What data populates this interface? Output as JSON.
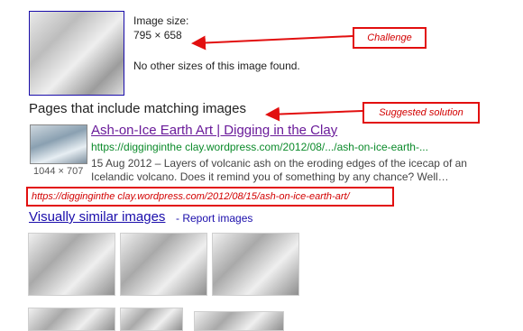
{
  "image_info": {
    "size_label": "Image size:",
    "size_value": "795 × 658",
    "other_sizes": "No other sizes of this image found."
  },
  "section": {
    "pages_title": "Pages that include matching images"
  },
  "result": {
    "title": "Ash-on-Ice Earth Art | Digging in the Clay",
    "url": "https://digginginthe clay.wordpress.com/2012/08/.../ash-on-ice-earth-...",
    "thumb_dims": "1044 × 707",
    "snippet": "15 Aug 2012 – Layers of volcanic ash on the eroding edges of the icecap of an Icelandic volcano. Does it remind you of something by any chance? Well…"
  },
  "annotations": {
    "challenge": "Challenge",
    "suggested": "Suggested solution",
    "full_url": "https://digginginthe clay.wordpress.com/2012/08/15/ash-on-ice-earth-art/"
  },
  "similar": {
    "link": "Visually similar images",
    "report": "- Report images"
  },
  "colors": {
    "link_blue": "#1a0dab",
    "visited_purple": "#6a1b9a",
    "url_green": "#0b8a2a",
    "annotation_red": "#e20f0f"
  }
}
